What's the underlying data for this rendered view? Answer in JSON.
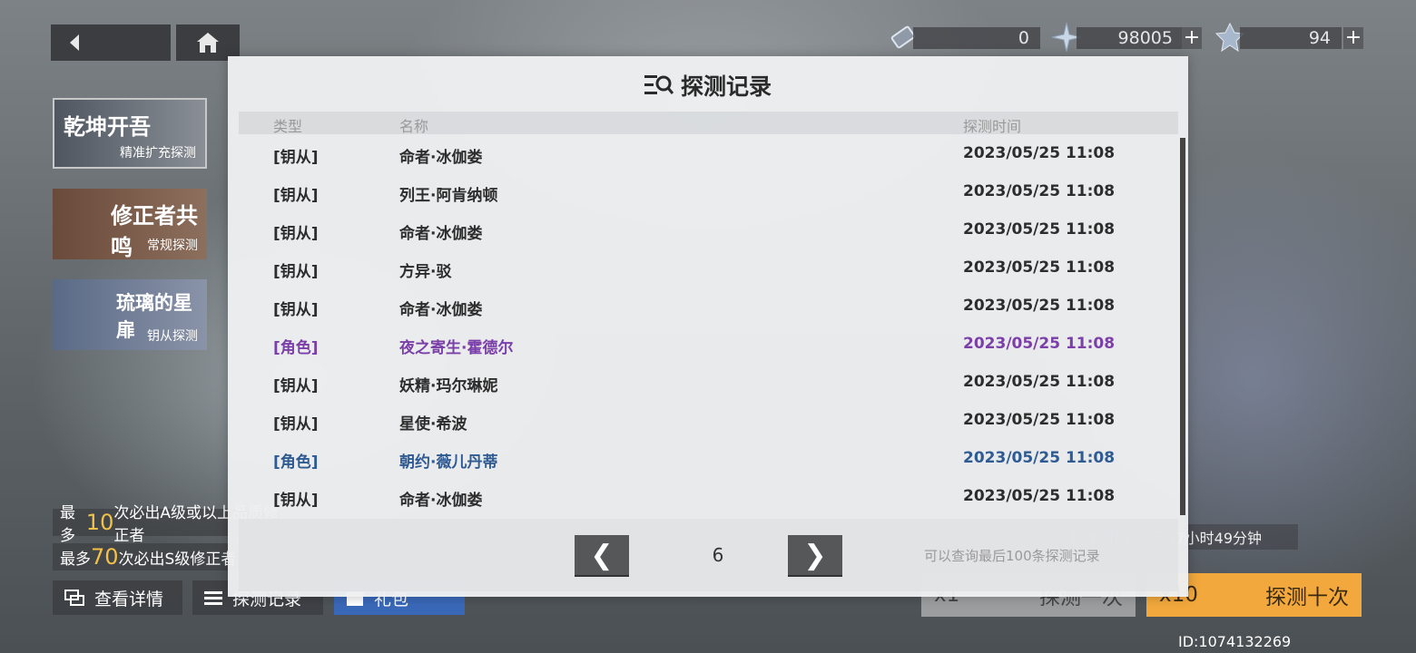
{
  "currencies": [
    {
      "icon": "ticket-icon",
      "value": "0"
    },
    {
      "icon": "crystal-icon",
      "value": "98005"
    },
    {
      "icon": "gem-icon",
      "value": "94"
    }
  ],
  "banners": [
    {
      "title": "乾坤开吾",
      "subtitle": "精准扩充探测"
    },
    {
      "title": "修正者共鸣",
      "subtitle": "常规探测"
    },
    {
      "title": "琉璃的星扉",
      "subtitle": "钥从探测"
    }
  ],
  "hints": [
    {
      "prefix": "最多",
      "num": "10",
      "suffix": "次必出A级或以上品质修正者"
    },
    {
      "prefix": "最多",
      "num": "70",
      "suffix": "次必出S级修正者"
    }
  ],
  "bottom": {
    "details": "查看详情",
    "records": "探测记录",
    "gift": "礼包",
    "draw_one_count": "x1",
    "draw_one_label": "探测一次",
    "draw_ten_count": "x10",
    "draw_ten_label": "探测十次",
    "timer": "剩余时间 25天17小时49分钟",
    "user_id": "ID:1074132269"
  },
  "modal": {
    "title": "探测记录",
    "headers": {
      "type": "类型",
      "name": "名称",
      "time": "探测时间"
    },
    "rows": [
      {
        "type": "[钥从]",
        "name": "命者·冰伽娄",
        "time": "2023/05/25 11:08"
      },
      {
        "type": "[钥从]",
        "name": "列王·阿肯纳顿",
        "time": "2023/05/25 11:08"
      },
      {
        "type": "[钥从]",
        "name": "命者·冰伽娄",
        "time": "2023/05/25 11:08"
      },
      {
        "type": "[钥从]",
        "name": "方异·驳",
        "time": "2023/05/25 11:08"
      },
      {
        "type": "[钥从]",
        "name": "命者·冰伽娄",
        "time": "2023/05/25 11:08"
      },
      {
        "type": "[角色]",
        "name": "夜之寄生·霍德尔",
        "time": "2023/05/25 11:08"
      },
      {
        "type": "[钥从]",
        "name": "妖精·玛尔琳妮",
        "time": "2023/05/25 11:08"
      },
      {
        "type": "[钥从]",
        "name": "星使·希波",
        "time": "2023/05/25 11:08"
      },
      {
        "type": "[角色]",
        "name": "朝约·薇儿丹蒂",
        "time": "2023/05/25 11:08"
      },
      {
        "type": "[钥从]",
        "name": "命者·冰伽娄",
        "time": "2023/05/25 11:08"
      }
    ],
    "page": "6",
    "note": "可以查询最后100条探测记录",
    "prev_glyph": "❮",
    "next_glyph": "❯"
  },
  "colors": {
    "purple_rarity": "#7a3fa8",
    "blue_rarity": "#2f5a92",
    "gold_hint": "#f2c14a",
    "draw_ten_bg": "#f2a83c"
  }
}
